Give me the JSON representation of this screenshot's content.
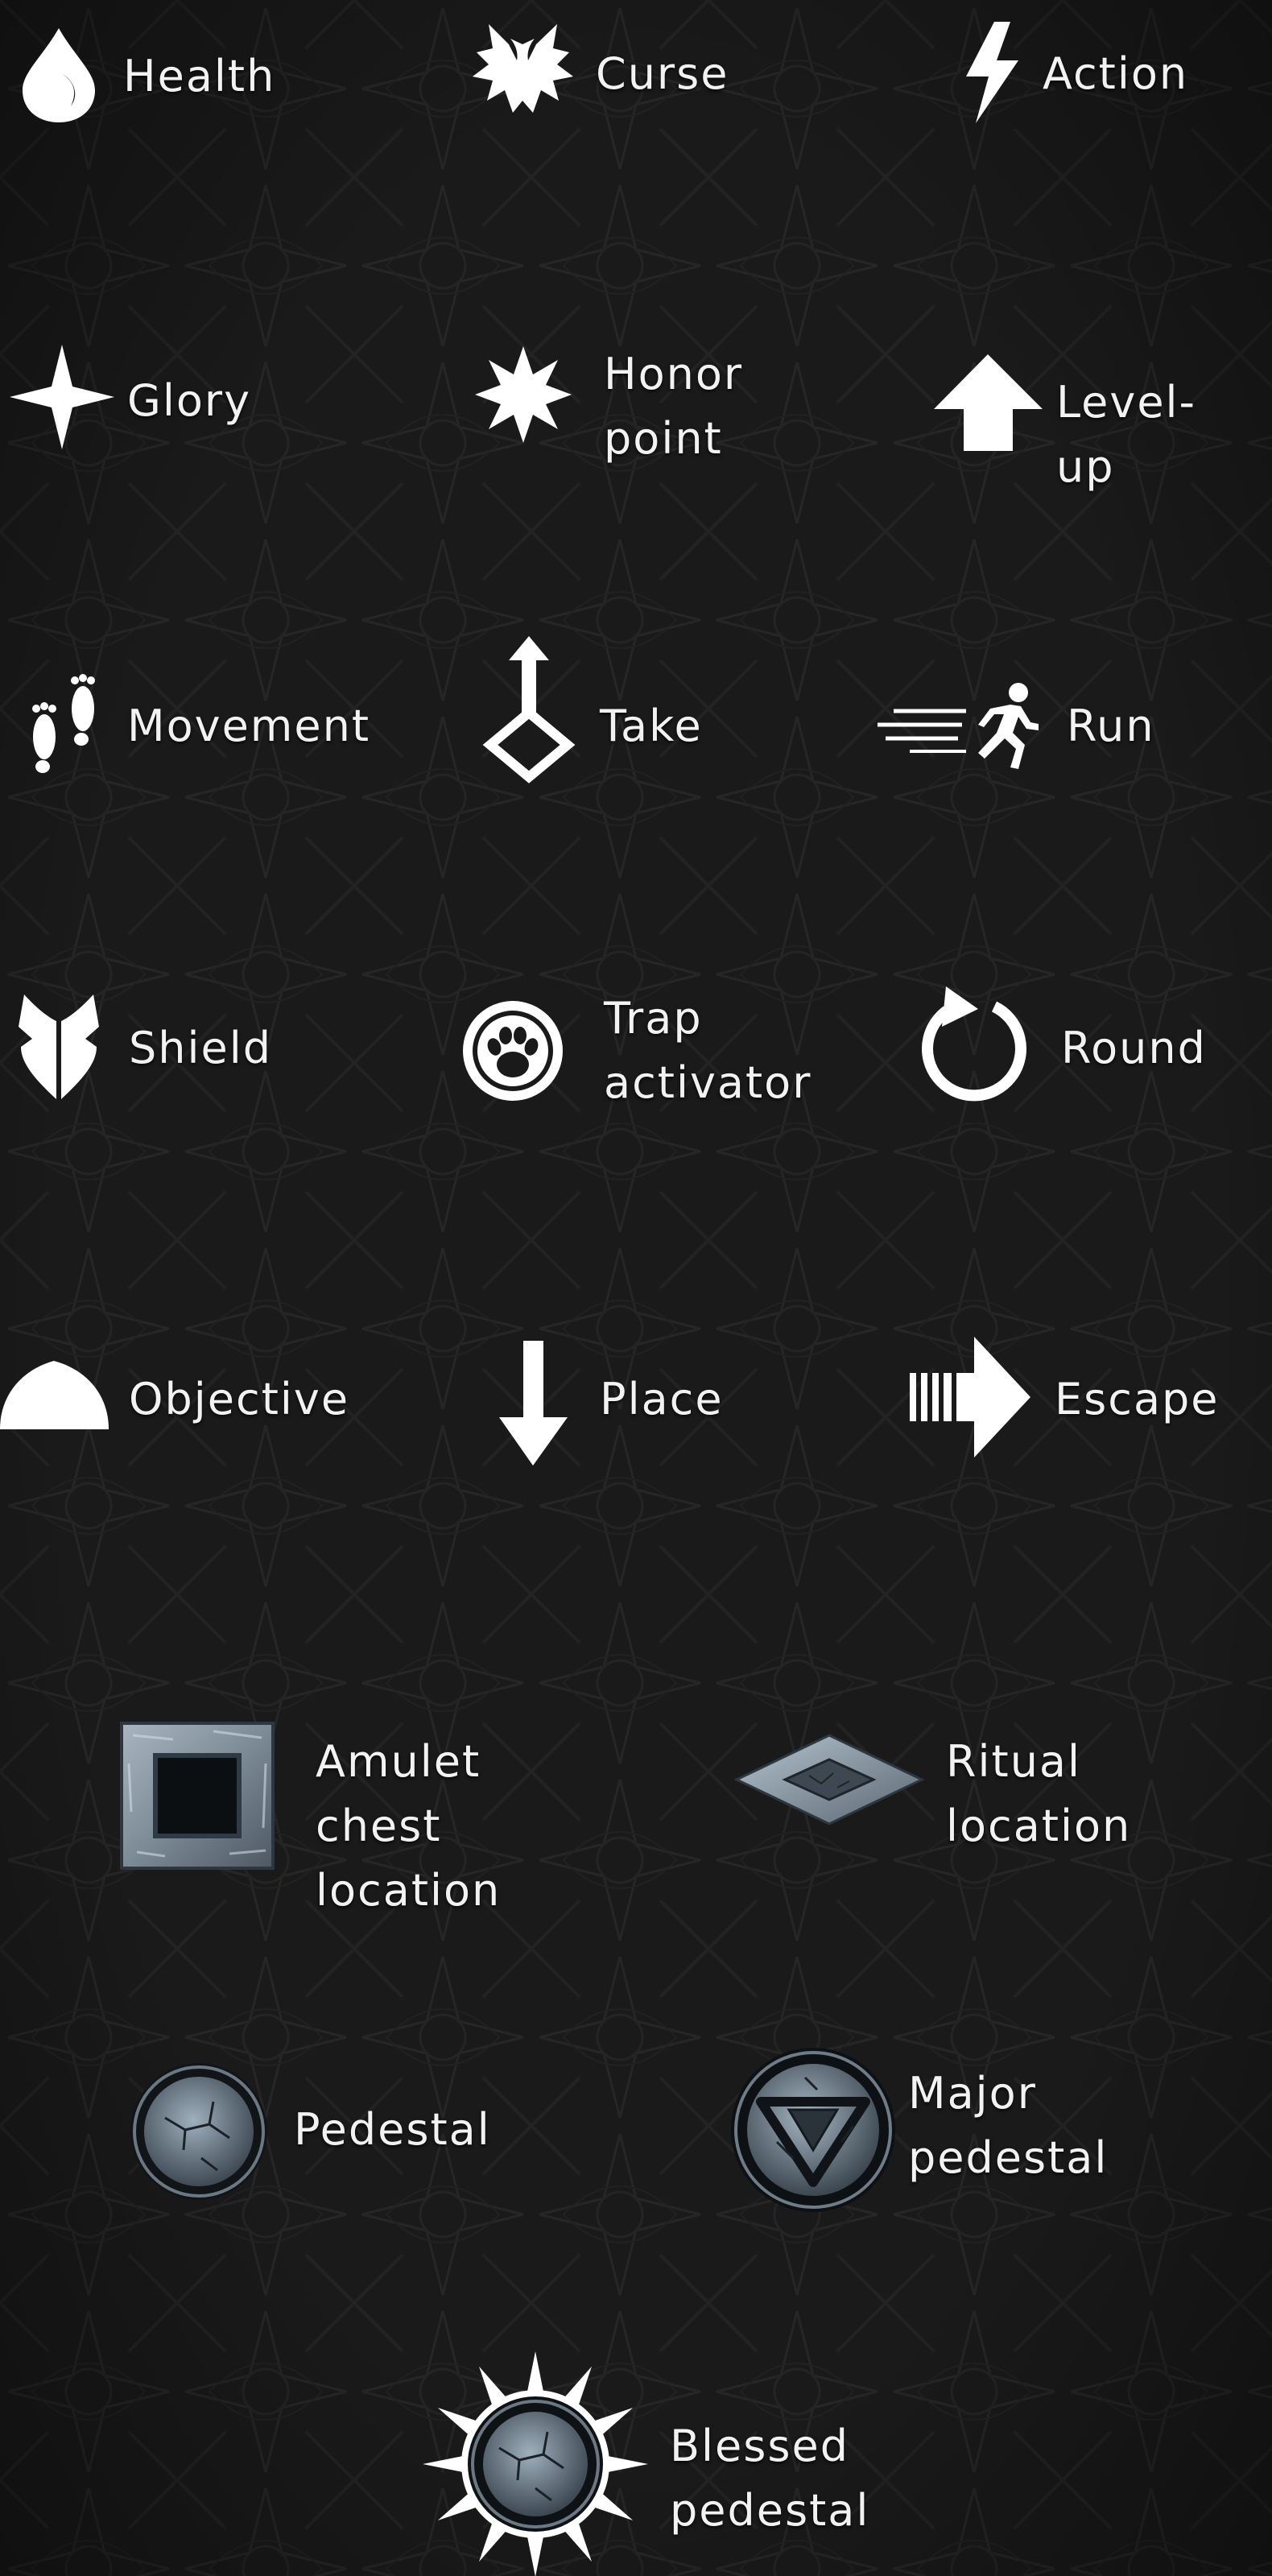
{
  "legend": {
    "items": [
      {
        "id": "health",
        "label": "Health",
        "icon": "droplet-icon"
      },
      {
        "id": "curse",
        "label": "Curse",
        "icon": "curse-icon"
      },
      {
        "id": "action",
        "label": "Action",
        "icon": "lightning-icon"
      },
      {
        "id": "glory",
        "label": "Glory",
        "icon": "four-point-star-icon"
      },
      {
        "id": "honor",
        "label": "Honor\npoint",
        "icon": "starburst-icon"
      },
      {
        "id": "levelup",
        "label": "Level-up",
        "icon": "up-arrow-icon"
      },
      {
        "id": "movement",
        "label": "Movement",
        "icon": "footprints-icon"
      },
      {
        "id": "take",
        "label": "Take",
        "icon": "take-icon"
      },
      {
        "id": "run",
        "label": "Run",
        "icon": "runner-icon"
      },
      {
        "id": "shield",
        "label": "Shield",
        "icon": "shield-icon"
      },
      {
        "id": "trap",
        "label": "Trap\nactivator",
        "icon": "paw-icon"
      },
      {
        "id": "round",
        "label": "Round",
        "icon": "round-arrow-icon"
      },
      {
        "id": "objective",
        "label": "Objective",
        "icon": "dome-icon"
      },
      {
        "id": "place",
        "label": "Place",
        "icon": "down-arrow-icon"
      },
      {
        "id": "escape",
        "label": "Escape",
        "icon": "escape-arrow-icon"
      },
      {
        "id": "amulet",
        "label": "Amulet chest\nlocation",
        "icon": "stone-frame-icon"
      },
      {
        "id": "ritual",
        "label": "Ritual\nlocation",
        "icon": "stone-diamond-icon"
      },
      {
        "id": "pedestal",
        "label": "Pedestal",
        "icon": "pedestal-icon"
      },
      {
        "id": "major",
        "label": "Major\npedestal",
        "icon": "major-pedestal-icon"
      },
      {
        "id": "blessed",
        "label": "Blessed\npedestal",
        "icon": "blessed-pedestal-icon"
      }
    ]
  },
  "colors": {
    "background": "#1a1a1a",
    "pattern": "#2b2b2b",
    "icon": "#ffffff",
    "text": "#f2f2f2",
    "stone": "#8a99a6"
  }
}
